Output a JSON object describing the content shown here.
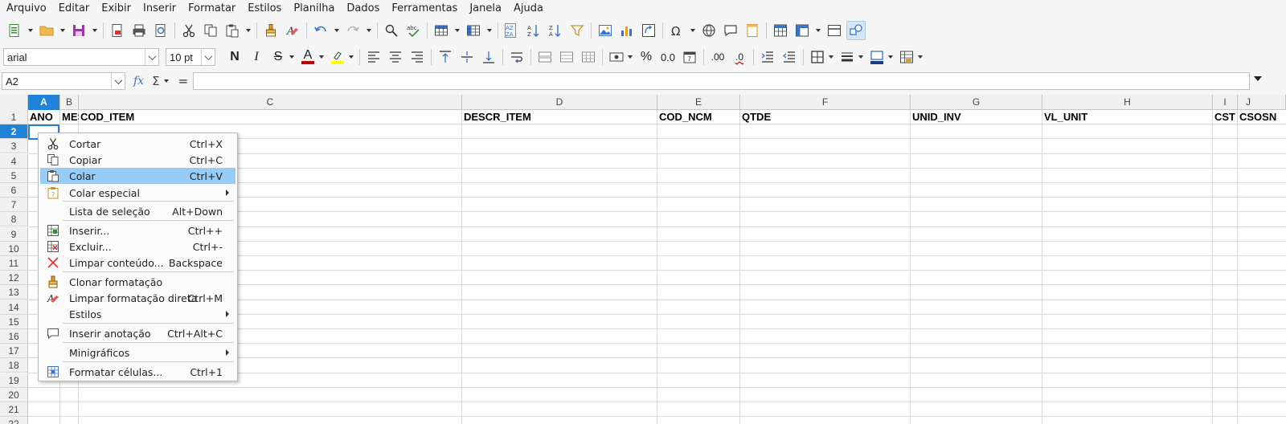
{
  "menubar": [
    "Arquivo",
    "Editar",
    "Exibir",
    "Inserir",
    "Formatar",
    "Estilos",
    "Planilha",
    "Dados",
    "Ferramentas",
    "Janela",
    "Ajuda"
  ],
  "toolbar2": {
    "font_name": "arial",
    "font_size": "10 pt",
    "bold_glyph": "N",
    "italic_glyph": "I",
    "strike_glyph": "S",
    "font_color_glyph": "A",
    "percent_glyph": "%",
    "number_glyph": "0.0",
    "add_decimal_glyph": ".00",
    "remove_decimal_glyph": ".0"
  },
  "formula_bar": {
    "name_box": "A2",
    "fx_label": "fx",
    "sigma_label": "Σ",
    "equals_label": "=",
    "content": ""
  },
  "columns": [
    "A",
    "B",
    "C",
    "D",
    "E",
    "F",
    "G",
    "H",
    "I",
    "J"
  ],
  "rows": [
    "1",
    "2",
    "3",
    "4",
    "5",
    "6",
    "7",
    "8",
    "9",
    "10",
    "11",
    "12",
    "13",
    "14",
    "15",
    "16",
    "17",
    "18",
    "19",
    "20",
    "21",
    "22"
  ],
  "row1_values": {
    "A": "ANO",
    "B": "MES",
    "C": "COD_ITEM",
    "D": "DESCR_ITEM",
    "E": "COD_NCM",
    "F": "QTDE",
    "G": "UNID_INV",
    "H": "VL_UNIT",
    "I": "CST",
    "J": "CSOSN"
  },
  "selected_cell": "A2",
  "context_menu": {
    "items": [
      {
        "label": "Cortar",
        "shortcut": "Ctrl+X",
        "icon": "scissors-icon"
      },
      {
        "label": "Copiar",
        "shortcut": "Ctrl+C",
        "icon": "copy-icon"
      },
      {
        "label": "Colar",
        "shortcut": "Ctrl+V",
        "icon": "paste-icon",
        "highlighted": true
      },
      {
        "label": "Colar especial",
        "shortcut": "",
        "icon": "paste-special-icon",
        "submenu": true
      },
      {
        "label": "Lista de seleção",
        "shortcut": "Alt+Down",
        "icon": ""
      },
      {
        "label": "Inserir...",
        "shortcut": "Ctrl++",
        "icon": "insert-cells-icon"
      },
      {
        "label": "Excluir...",
        "shortcut": "Ctrl+-",
        "icon": "delete-cells-icon"
      },
      {
        "label": "Limpar conteúdo...",
        "shortcut": "Backspace",
        "icon": "clear-x-icon"
      },
      {
        "label": "Clonar formatação",
        "shortcut": "",
        "icon": "clone-brush-icon"
      },
      {
        "label": "Limpar formatação direta",
        "shortcut": "Ctrl+M",
        "icon": "clear-format-icon"
      },
      {
        "label": "Estilos",
        "shortcut": "",
        "icon": "",
        "submenu": true
      },
      {
        "label": "Inserir anotação",
        "shortcut": "Ctrl+Alt+C",
        "icon": "comment-icon"
      },
      {
        "label": "Minigráficos",
        "shortcut": "",
        "icon": "",
        "submenu": true
      },
      {
        "label": "Formatar células...",
        "shortcut": "Ctrl+1",
        "icon": "format-cells-icon"
      }
    ]
  },
  "colors": {
    "selection_blue": "#1f83d8",
    "menu_highlight": "#99ccf5",
    "font_color_bar": "#c00000",
    "highlight_bar": "#ffff00"
  }
}
